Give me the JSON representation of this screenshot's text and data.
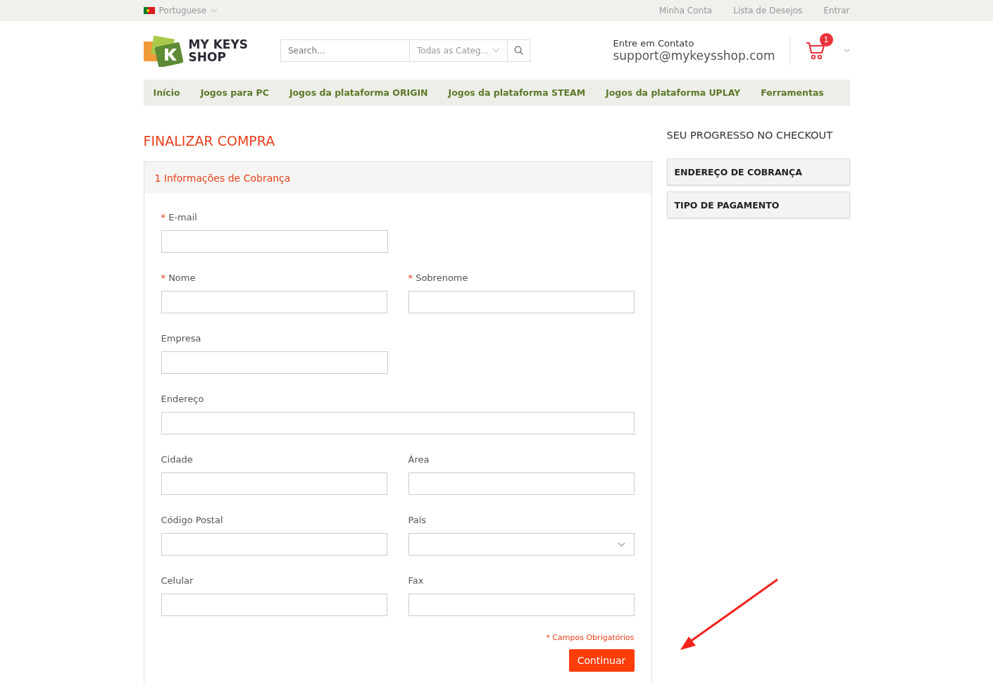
{
  "top_bar": {
    "language": "Portuguese",
    "links": [
      "Minha Conta",
      "Lista de Desejos",
      "Entrar"
    ]
  },
  "header": {
    "logo_lines": [
      "MY KEYS",
      "SHOP"
    ],
    "search": {
      "placeholder": "Search..."
    },
    "category": "Todas as Categ...",
    "contact_label": "Entre em Contato",
    "contact_email": "support@mykeysshop.com",
    "cart_count": "1"
  },
  "nav": [
    "Início",
    "Jogos para PC",
    "Jogos da plataforma ORIGIN",
    "Jogos da plataforma STEAM",
    "Jogos da plataforma UPLAY",
    "Ferramentas"
  ],
  "page_title": "FINALIZAR COMPRA",
  "section": {
    "title": "1 Informações de Cobrança",
    "rows": [
      [
        {
          "label": "E-mail",
          "required_mark": "*",
          "kind": "text"
        }
      ],
      [
        {
          "label": "Nome",
          "required_mark": "*",
          "kind": "text"
        },
        {
          "label": "Sobrenome",
          "required_mark": "*",
          "kind": "text"
        }
      ],
      [
        {
          "label": "Empresa",
          "kind": "text"
        }
      ],
      [
        {
          "label": "Endereço",
          "kind": "wide"
        }
      ],
      [
        {
          "label": "Cidade",
          "kind": "text"
        },
        {
          "label": "Área",
          "kind": "text"
        }
      ],
      [
        {
          "label": "Código Postal",
          "kind": "text"
        },
        {
          "label": "País",
          "kind": "select"
        }
      ],
      [
        {
          "label": "Celular",
          "kind": "text"
        },
        {
          "label": "Fax",
          "kind": "text"
        }
      ]
    ],
    "required_note": "* Campos Obrigatórios",
    "button": "Continuar"
  },
  "progress": {
    "title": "SEU PROGRESSO NO CHECKOUT",
    "steps": [
      "ENDEREÇO DE COBRANÇA",
      "TIPO DE PAGAMENTO"
    ]
  }
}
